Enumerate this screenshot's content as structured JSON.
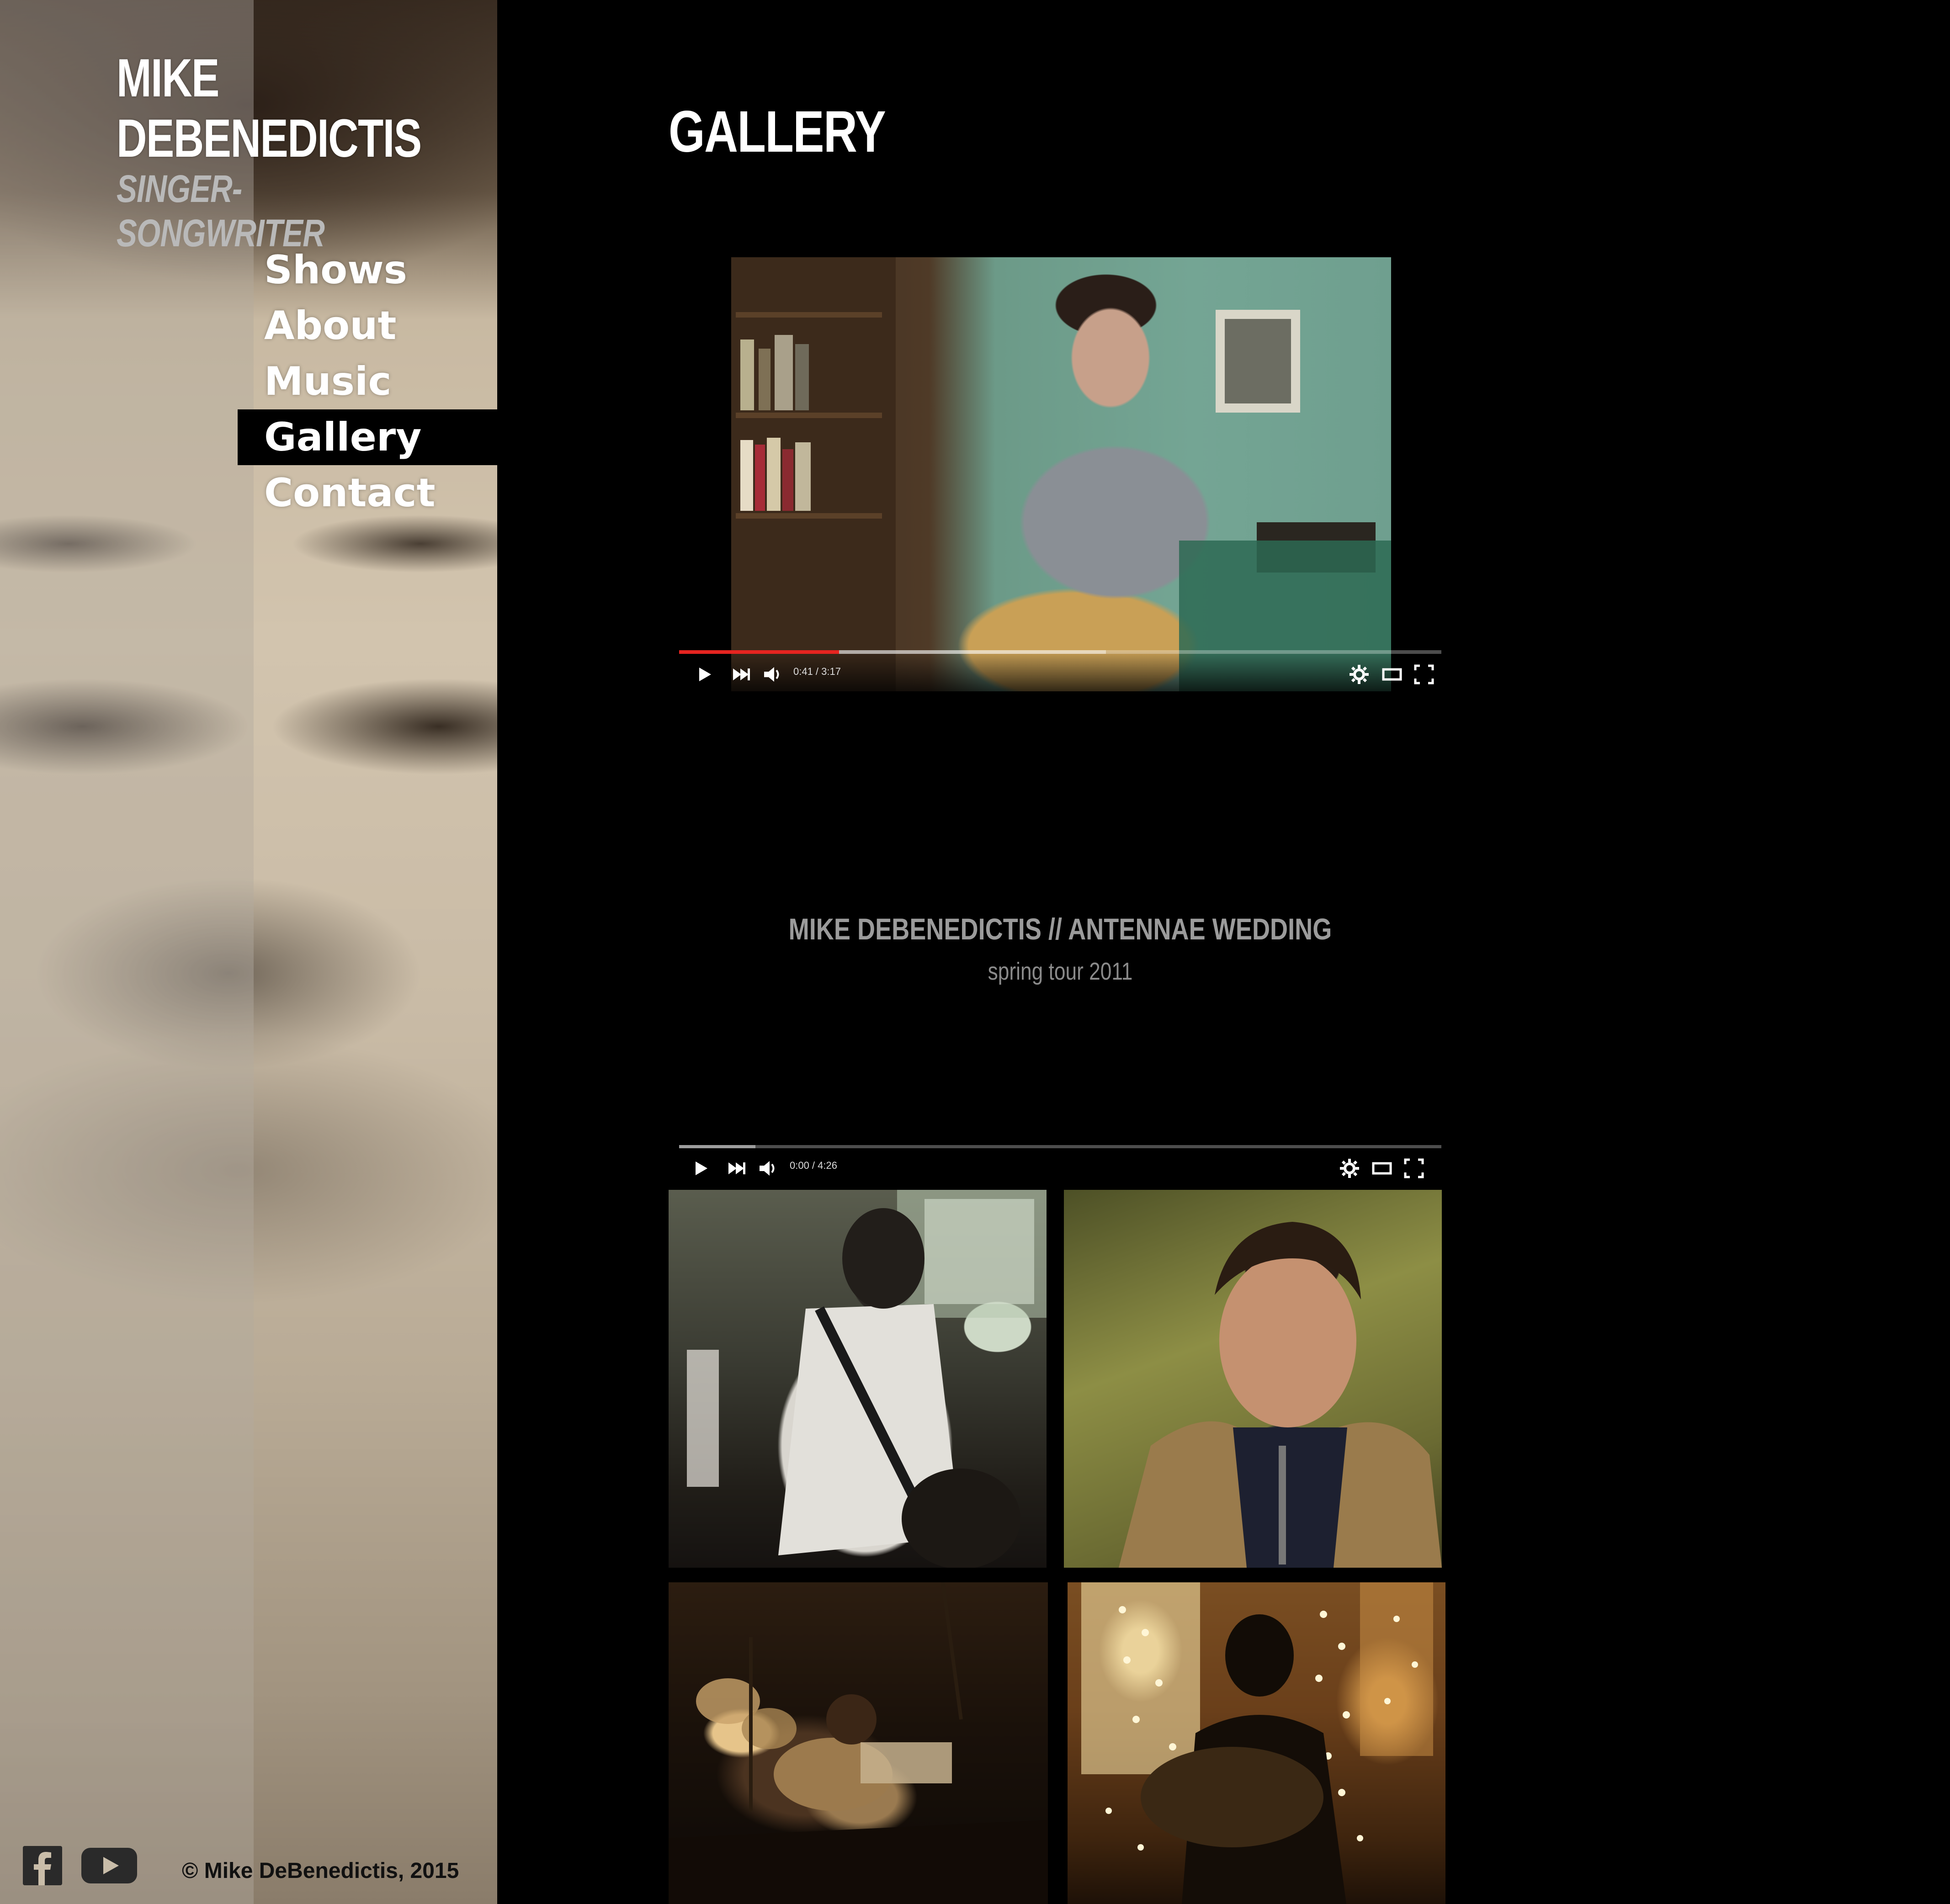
{
  "site": {
    "name_line1": "MIKE",
    "name_line2": "DEBENEDICTIS",
    "tagline": "SINGER-SONGWRITER"
  },
  "nav": {
    "items": [
      {
        "label": "Shows",
        "active": false
      },
      {
        "label": "About",
        "active": false
      },
      {
        "label": "Music",
        "active": false
      },
      {
        "label": "Gallery",
        "active": true
      },
      {
        "label": "Contact",
        "active": false
      }
    ]
  },
  "page": {
    "title": "GALLERY"
  },
  "videos": [
    {
      "time": "0:41 / 3:17",
      "progress_played": 0.21,
      "progress_loaded": 0.56,
      "controls": [
        "play-icon",
        "next-icon",
        "volume-icon",
        "settings-icon",
        "theater-mode-icon",
        "fullscreen-icon"
      ]
    },
    {
      "title": "MIKE DEBENEDICTIS // ANTENNAE WEDDING",
      "subtitle": "spring tour 2011",
      "time": "0:00 / 4:26",
      "progress_played": 0.0,
      "progress_loaded": 0.1,
      "controls": [
        "play-icon",
        "next-icon",
        "volume-icon",
        "settings-icon",
        "theater-mode-icon",
        "fullscreen-icon"
      ]
    }
  ],
  "photos": [
    {
      "subject": "performer from behind with guitar"
    },
    {
      "subject": "portrait in hooded jacket"
    },
    {
      "subject": "playing guitar on stage with drum kit"
    },
    {
      "subject": "silhouette playing guitar by string lights"
    }
  ],
  "footer": {
    "social": [
      "facebook-icon",
      "youtube-icon"
    ],
    "copyright": "© Mike DeBenedictis, 2015"
  },
  "colors": {
    "background": "#000000",
    "nav_text": "#ffffff",
    "active_nav_bg": "#000000",
    "progress_played": "#e52420",
    "tagline": "#b9b9b9"
  }
}
